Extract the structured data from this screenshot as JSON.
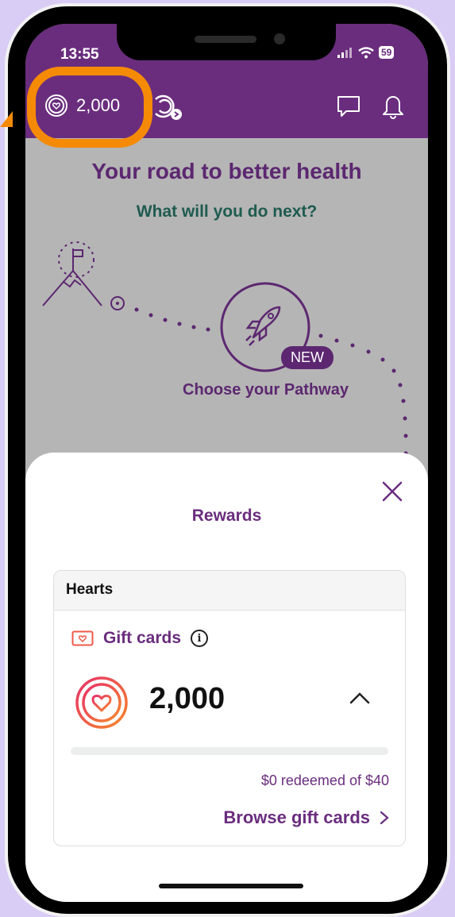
{
  "status_bar": {
    "time": "13:55",
    "battery": "59"
  },
  "header": {
    "points": "2,000"
  },
  "home": {
    "title": "Your road to better health",
    "subtitle": "What will you do next?",
    "new_badge": "NEW",
    "pathway_label": "Choose your Pathway"
  },
  "sheet": {
    "title": "Rewards",
    "card": {
      "header": "Hearts",
      "gift_cards_label": "Gift cards",
      "balance": "2,000",
      "progress_fraction": 0,
      "redeemed_text": "$0 redeemed of $40",
      "browse_label": "Browse gift cards"
    }
  },
  "colors": {
    "brand_purple": "#6a2d7e",
    "highlight_orange": "#f58a07",
    "title_purple": "#5c2770",
    "subtitle_green": "#1f5b4f"
  },
  "icons": [
    "heart-coin-icon",
    "streak-icon",
    "message-icon",
    "bell-icon",
    "rocket-icon",
    "mountain-flag-icon",
    "close-icon",
    "gift-card-icon",
    "info-icon",
    "chevron-up-icon",
    "chevron-right-icon"
  ]
}
